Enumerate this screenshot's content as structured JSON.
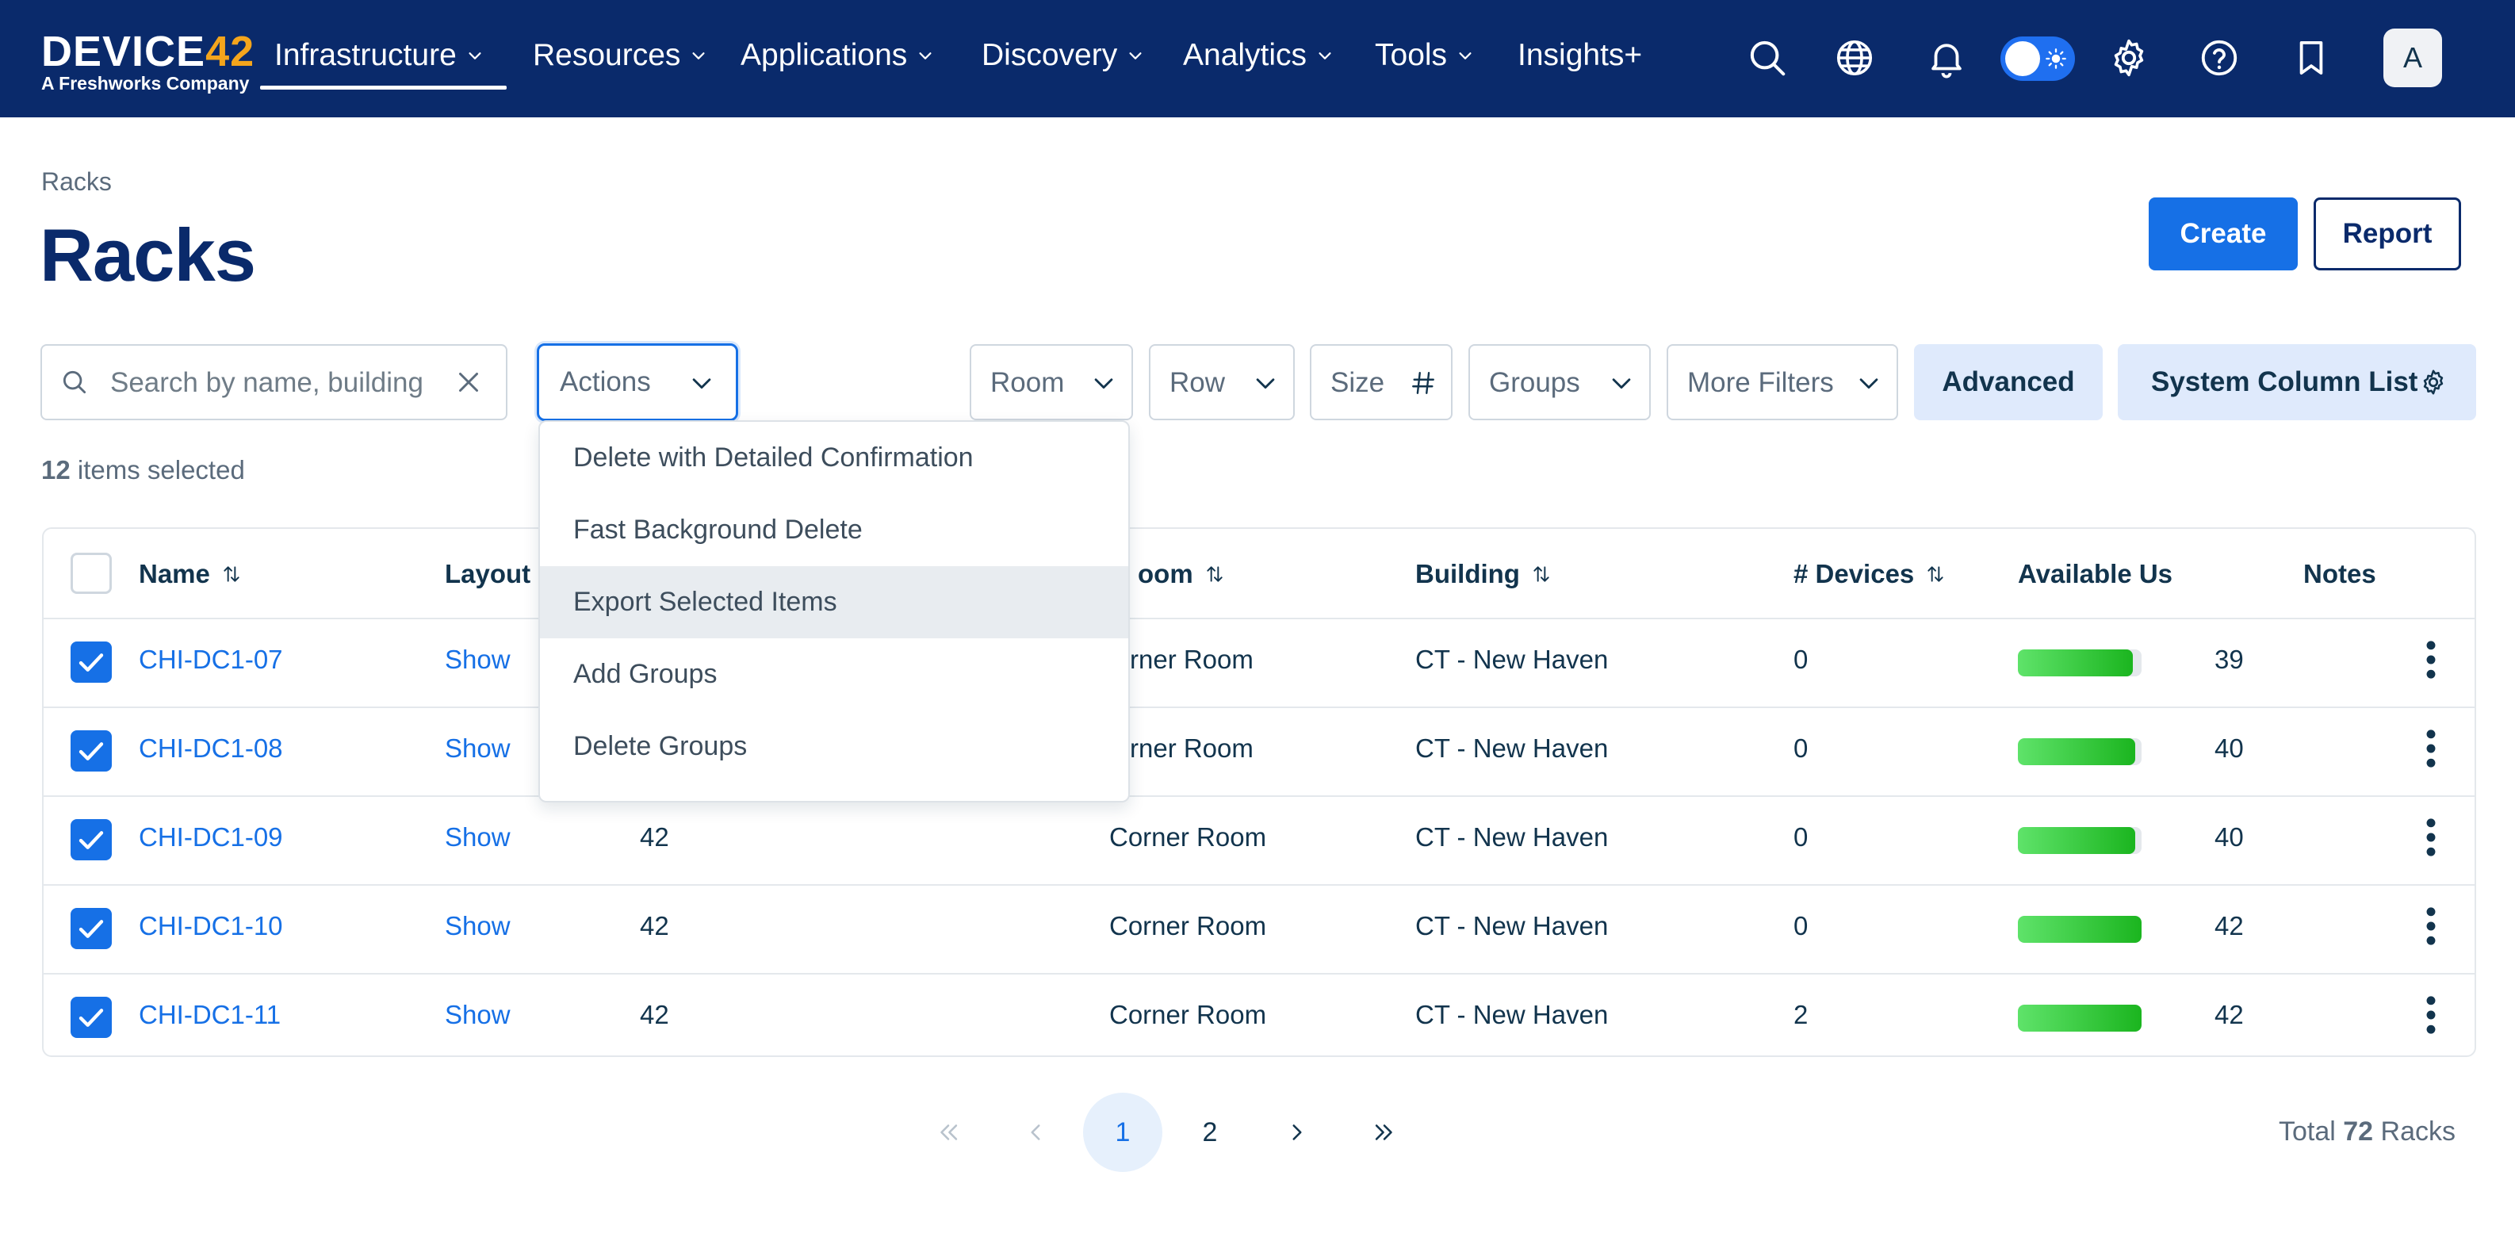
{
  "header": {
    "logo_text_a": "DEVICE",
    "logo_text_b": "42",
    "logo_sub": "A Freshworks Company",
    "nav": [
      {
        "label": "Infrastructure"
      },
      {
        "label": "Resources"
      },
      {
        "label": "Applications"
      },
      {
        "label": "Discovery"
      },
      {
        "label": "Analytics"
      },
      {
        "label": "Tools"
      },
      {
        "label": "Insights+"
      }
    ],
    "avatar_letter": "A"
  },
  "breadcrumb": "Racks",
  "page_title": "Racks",
  "buttons": {
    "create": "Create",
    "report": "Report",
    "advanced": "Advanced",
    "system_column_list": "System Column List"
  },
  "search": {
    "placeholder": "Search by name, building"
  },
  "actions": {
    "label": "Actions"
  },
  "filters": {
    "room": "Room",
    "row": "Row",
    "size": "Size",
    "groups": "Groups",
    "more": "More Filters"
  },
  "selection": {
    "count": "12",
    "suffix": " items selected"
  },
  "dropdown": {
    "items": [
      "Delete with Detailed Confirmation",
      "Fast Background Delete",
      "Export Selected Items",
      "Add Groups",
      "Delete Groups"
    ],
    "highlighted_index": 2
  },
  "table": {
    "columns": {
      "name": "Name",
      "layout": "Layout",
      "room": "oom",
      "building": "Building",
      "devices": "# Devices",
      "available": "Available Us",
      "notes": "Notes"
    },
    "rows": [
      {
        "name": "CHI-DC1-07",
        "layout": "Show",
        "size": "",
        "room": "rner Room",
        "building": "CT - New Haven",
        "devices": "0",
        "available": "39",
        "fill": 0.93
      },
      {
        "name": "CHI-DC1-08",
        "layout": "Show",
        "size": "",
        "room": "rner Room",
        "building": "CT - New Haven",
        "devices": "0",
        "available": "40",
        "fill": 0.95
      },
      {
        "name": "CHI-DC1-09",
        "layout": "Show",
        "size": "42",
        "room": "Corner Room",
        "building": "CT - New Haven",
        "devices": "0",
        "available": "40",
        "fill": 0.95
      },
      {
        "name": "CHI-DC1-10",
        "layout": "Show",
        "size": "42",
        "room": "Corner Room",
        "building": "CT - New Haven",
        "devices": "0",
        "available": "42",
        "fill": 1.0
      },
      {
        "name": "CHI-DC1-11",
        "layout": "Show",
        "size": "42",
        "room": "Corner Room",
        "building": "CT - New Haven",
        "devices": "2",
        "available": "42",
        "fill": 1.0
      }
    ]
  },
  "pagination": {
    "pages": [
      "1",
      "2"
    ],
    "current": "1",
    "total_prefix": "Total ",
    "total_count": "72",
    "total_suffix": " Racks"
  },
  "colors": {
    "header_bg": "#0a2a6b",
    "accent": "#1670e6",
    "logo_accent": "#f4a51c",
    "bar_green": "#1bb51f"
  }
}
